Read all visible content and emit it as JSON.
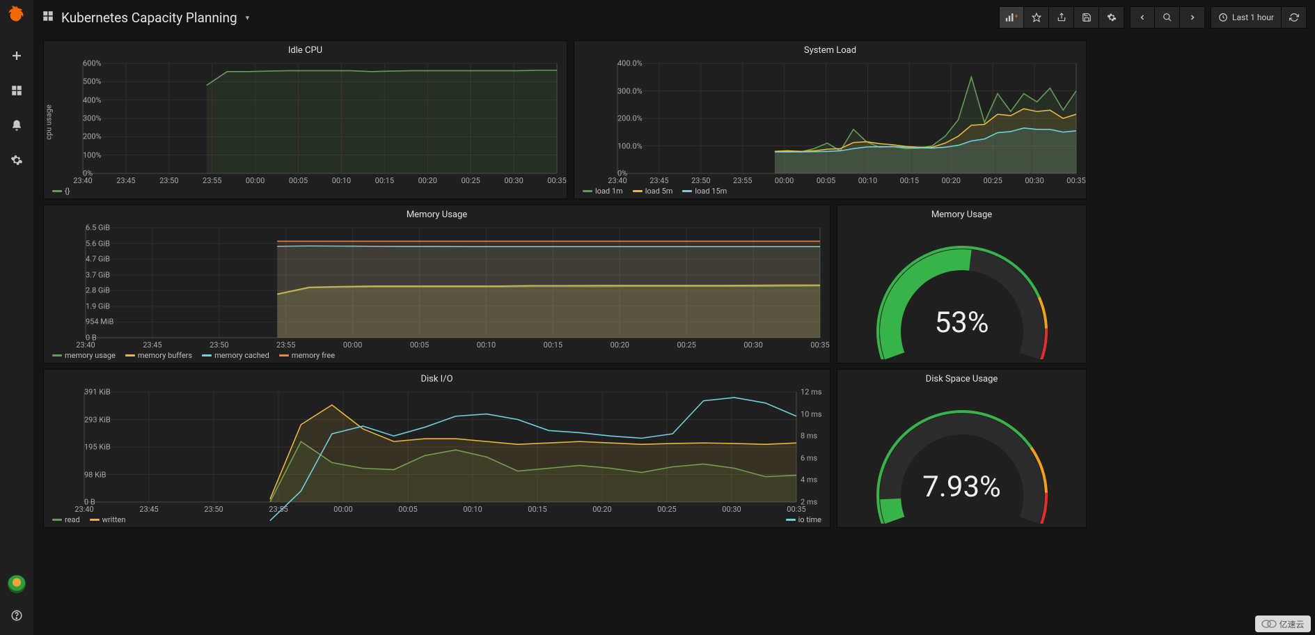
{
  "header": {
    "title": "Kubernetes Capacity Planning",
    "time_range": "Last 1 hour"
  },
  "panels": {
    "idle_cpu": {
      "title": "Idle CPU",
      "ylabel": "cpu usage",
      "legend": [
        "{}"
      ]
    },
    "system_load": {
      "title": "System Load",
      "legend": [
        "load 1m",
        "load 5m",
        "load 15m"
      ]
    },
    "memory_usage": {
      "title": "Memory Usage",
      "legend": [
        "memory usage",
        "memory buffers",
        "memory cached",
        "memory free"
      ]
    },
    "memory_gauge": {
      "title": "Memory Usage",
      "value": "53%"
    },
    "disk_io": {
      "title": "Disk I/O",
      "legend_left": [
        "read",
        "written"
      ],
      "legend_right": [
        "io time"
      ]
    },
    "disk_gauge": {
      "title": "Disk Space Usage",
      "value": "7.93%"
    }
  },
  "chart_data": [
    {
      "id": "idle_cpu",
      "type": "line",
      "x": [
        "23:40",
        "23:45",
        "23:50",
        "23:55",
        "00:00",
        "00:05",
        "00:10",
        "00:15",
        "00:20",
        "00:25",
        "00:30",
        "00:35"
      ],
      "series": [
        {
          "name": "{}",
          "color": "#629e51",
          "values": [
            null,
            null,
            null,
            null,
            null,
            null,
            480,
            555,
            555,
            558,
            560,
            560,
            560,
            560,
            555,
            558,
            560,
            560,
            560,
            560,
            560,
            560,
            562,
            562
          ]
        }
      ],
      "ylim": [
        0,
        600
      ],
      "yticks": [
        "0%",
        "100%",
        "200%",
        "300%",
        "400%",
        "500%",
        "600%"
      ],
      "ylabel": "cpu usage",
      "fill": true
    },
    {
      "id": "system_load",
      "type": "line",
      "x": [
        "23:40",
        "23:45",
        "23:50",
        "23:55",
        "00:00",
        "00:05",
        "00:10",
        "00:15",
        "00:20",
        "00:25",
        "00:30",
        "00:35"
      ],
      "series": [
        {
          "name": "load 1m",
          "color": "#629e51",
          "values": [
            null,
            null,
            null,
            null,
            null,
            null,
            null,
            null,
            null,
            null,
            null,
            null,
            80,
            82,
            78,
            90,
            110,
            82,
            160,
            115,
            95,
            98,
            90,
            92,
            100,
            135,
            195,
            350,
            185,
            290,
            225,
            290,
            260,
            310,
            230,
            300
          ]
        },
        {
          "name": "load 5m",
          "color": "#eab839",
          "values": [
            null,
            null,
            null,
            null,
            null,
            null,
            null,
            null,
            null,
            null,
            null,
            null,
            80,
            82,
            80,
            82,
            88,
            90,
            112,
            115,
            108,
            104,
            98,
            95,
            95,
            110,
            135,
            175,
            178,
            215,
            210,
            235,
            225,
            230,
            200,
            215
          ]
        },
        {
          "name": "load 15m",
          "color": "#6ed0e0",
          "values": [
            null,
            null,
            null,
            null,
            null,
            null,
            null,
            null,
            null,
            null,
            null,
            null,
            78,
            78,
            78,
            79,
            80,
            82,
            90,
            96,
            97,
            97,
            95,
            93,
            92,
            95,
            102,
            118,
            125,
            148,
            152,
            165,
            160,
            160,
            150,
            155
          ]
        }
      ],
      "ylim": [
        0,
        400
      ],
      "yticks": [
        "0%",
        "100.0%",
        "200.0%",
        "300.0%",
        "400.0%"
      ],
      "fill": true
    },
    {
      "id": "memory_usage",
      "type": "line",
      "x": [
        "23:40",
        "23:45",
        "23:50",
        "23:55",
        "00:00",
        "00:05",
        "00:10",
        "00:15",
        "00:20",
        "00:25",
        "00:30",
        "00:35"
      ],
      "series": [
        {
          "name": "memory usage",
          "color": "#629e51",
          "values": [
            null,
            null,
            null,
            null,
            null,
            null,
            2.55,
            2.95,
            2.98,
            3.0,
            3.0,
            3.0,
            3.0,
            3.0,
            3.02,
            3.02,
            3.02,
            3.03,
            3.03,
            3.03,
            3.03,
            3.03,
            3.05,
            3.06
          ]
        },
        {
          "name": "memory buffers",
          "color": "#eab839",
          "values": [
            null,
            null,
            null,
            null,
            null,
            null,
            2.58,
            2.98,
            3.02,
            3.05,
            3.05,
            3.05,
            3.05,
            3.05,
            3.08,
            3.08,
            3.09,
            3.09,
            3.09,
            3.09,
            3.09,
            3.1,
            3.11,
            3.11
          ]
        },
        {
          "name": "memory cached",
          "color": "#6ed0e0",
          "values": [
            null,
            null,
            null,
            null,
            null,
            null,
            5.4,
            5.42,
            5.41,
            5.4,
            5.39,
            5.39,
            5.38,
            5.38,
            5.38,
            5.38,
            5.38,
            5.38,
            5.38,
            5.38,
            5.38,
            5.38,
            5.38,
            5.38
          ]
        },
        {
          "name": "memory free",
          "color": "#ef843c",
          "values": [
            null,
            null,
            null,
            null,
            null,
            null,
            5.7,
            5.7,
            5.7,
            5.7,
            5.7,
            5.7,
            5.7,
            5.7,
            5.7,
            5.7,
            5.7,
            5.7,
            5.7,
            5.7,
            5.7,
            5.7,
            5.7,
            5.7
          ]
        }
      ],
      "ylim": [
        0,
        6.5
      ],
      "yticks": [
        "0 B",
        "954 MiB",
        "1.9 GiB",
        "2.8 GiB",
        "3.7 GiB",
        "4.7 GiB",
        "5.6 GiB",
        "6.5 GiB"
      ],
      "fill": true
    },
    {
      "id": "disk_io",
      "type": "line",
      "x": [
        "23:40",
        "23:45",
        "23:50",
        "23:55",
        "00:00",
        "00:05",
        "00:10",
        "00:15",
        "00:20",
        "00:25",
        "00:30",
        "00:35"
      ],
      "series": [
        {
          "name": "read",
          "color": "#629e51",
          "axis": "l",
          "values": [
            null,
            null,
            null,
            null,
            null,
            null,
            0,
            215,
            140,
            120,
            115,
            165,
            185,
            160,
            110,
            120,
            130,
            120,
            105,
            125,
            135,
            120,
            90,
            95
          ]
        },
        {
          "name": "written",
          "color": "#eab839",
          "axis": "l",
          "values": [
            null,
            null,
            null,
            null,
            null,
            null,
            10,
            275,
            345,
            260,
            215,
            225,
            225,
            215,
            205,
            210,
            215,
            210,
            205,
            208,
            210,
            208,
            205,
            210
          ]
        },
        {
          "name": "io time",
          "color": "#6ed0e0",
          "axis": "r",
          "values": [
            null,
            null,
            null,
            null,
            null,
            null,
            0.3,
            3.0,
            8.2,
            8.9,
            8.0,
            8.8,
            9.8,
            10.0,
            9.5,
            8.5,
            8.3,
            8.0,
            7.8,
            8.2,
            11.2,
            11.5,
            11.0,
            9.8
          ]
        }
      ],
      "ylim_l": [
        0,
        391
      ],
      "yticks_l": [
        "0 B",
        "98 KiB",
        "195 KiB",
        "293 KiB",
        "391 KiB"
      ],
      "ylim_r": [
        2,
        12
      ],
      "yticks_r": [
        "2 ms",
        "4 ms",
        "6 ms",
        "8 ms",
        "10 ms",
        "12 ms"
      ],
      "fill": true
    },
    {
      "id": "memory_gauge",
      "type": "gauge",
      "value": 53,
      "min": 0,
      "max": 100,
      "thresholds": [
        80,
        90
      ],
      "colors": [
        "#37b34a",
        "#f2a01e",
        "#e02f2f"
      ]
    },
    {
      "id": "disk_gauge",
      "type": "gauge",
      "value": 7.93,
      "min": 0,
      "max": 100,
      "thresholds": [
        75,
        90
      ],
      "colors": [
        "#37b34a",
        "#f2a01e",
        "#e02f2f"
      ]
    }
  ],
  "watermark": "亿速云"
}
